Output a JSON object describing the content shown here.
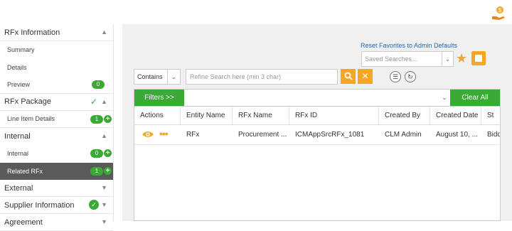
{
  "sidebar": {
    "sections": [
      {
        "title": "RFx Information",
        "expanded": true,
        "items": [
          {
            "label": "Summary"
          },
          {
            "label": "Details"
          },
          {
            "label": "Preview",
            "count": "0"
          }
        ]
      },
      {
        "title": "RFx Package",
        "expanded": true,
        "status": "complete",
        "items": [
          {
            "label": "Line Item Details",
            "count": "1"
          }
        ]
      },
      {
        "title": "Internal",
        "expanded": true,
        "items": [
          {
            "label": "Internal",
            "count": "0"
          },
          {
            "label": "Related RFx",
            "count": "1",
            "active": true
          }
        ]
      },
      {
        "title": "External",
        "expanded": false
      },
      {
        "title": "Supplier Information",
        "expanded": false,
        "status": "complete"
      },
      {
        "title": "Agreement",
        "expanded": false
      }
    ]
  },
  "toolbar": {
    "reset_link": "Reset Favorites to Admin Defaults",
    "saved_searches_placeholder": "Saved Searches...",
    "contains_label": "Contains",
    "search_placeholder": "Refine Search here (min 3 char)"
  },
  "filterbar": {
    "filters_label": "Filters >>",
    "clear_all_label": "Clear All"
  },
  "grid": {
    "columns": [
      "Actions",
      "Entity Name",
      "RFx Name",
      "RFx ID",
      "Created By",
      "Created Date",
      "St"
    ],
    "rows": [
      {
        "entity_name": "RFx",
        "rfx_name": "Procurement ...",
        "rfx_id": "ICMAppSrcRFx_1081",
        "created_by": "CLM Admin",
        "created_date": "August 10, ...",
        "status": "Bidd"
      }
    ]
  },
  "colors": {
    "accent_green": "#3aa935",
    "accent_orange": "#f5a623",
    "link_blue": "#2a6bb5",
    "active_item": "#5a5a5a"
  }
}
